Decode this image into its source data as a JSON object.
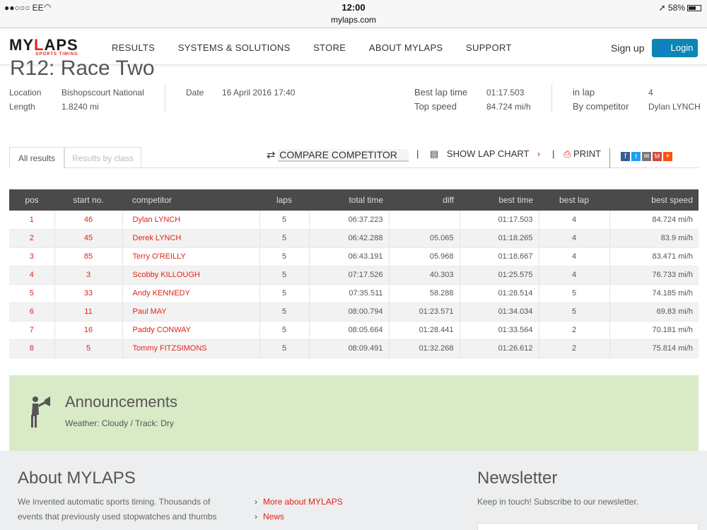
{
  "status": {
    "carrier": "●●○○○ EE",
    "time": "12:00",
    "url": "mylaps.com",
    "battery": "58%"
  },
  "nav": {
    "logo_main": "MYLAPS",
    "logo_sub": "SPORTS TIMING",
    "items": [
      "RESULTS",
      "SYSTEMS & SOLUTIONS",
      "STORE",
      "ABOUT MYLAPS",
      "SUPPORT"
    ],
    "signup": "Sign up",
    "login": "Login"
  },
  "race": {
    "title": "R12: Race Two",
    "location_label": "Location",
    "location": "Bishopscourt National",
    "length_label": "Length",
    "length": "1.8240 mi",
    "date_label": "Date",
    "date": "16 April 2016 17:40",
    "best_lap_time_label": "Best lap time",
    "best_lap_time": "01:17.503",
    "top_speed_label": "Top speed",
    "top_speed": "84.724 mi/h",
    "in_lap_label": "in lap",
    "in_lap": "4",
    "by_competitor_label": "By competitor",
    "by_competitor": "Dylan LYNCH"
  },
  "tabs": {
    "all": "All results",
    "by_class": "Results by class"
  },
  "tools": {
    "compare": "COMPARE COMPETITOR",
    "lap_chart": "SHOW LAP CHART",
    "print": "PRINT",
    "sep": "|"
  },
  "table": {
    "headers": [
      "pos",
      "start no.",
      "competitor",
      "laps",
      "total time",
      "diff",
      "best time",
      "best lap",
      "best speed"
    ],
    "rows": [
      [
        "1",
        "46",
        "Dylan LYNCH",
        "5",
        "06:37.223",
        "",
        "01:17.503",
        "4",
        "84.724 mi/h"
      ],
      [
        "2",
        "45",
        "Derek LYNCH",
        "5",
        "06:42.288",
        "05.065",
        "01:18.265",
        "4",
        "83.9 mi/h"
      ],
      [
        "3",
        "85",
        "Terry O'REILLY",
        "5",
        "06:43.191",
        "05.968",
        "01:18.667",
        "4",
        "83.471 mi/h"
      ],
      [
        "4",
        "3",
        "Scobby KILLOUGH",
        "5",
        "07:17.526",
        "40.303",
        "01:25.575",
        "4",
        "76.733 mi/h"
      ],
      [
        "5",
        "33",
        "Andy KENNEDY",
        "5",
        "07:35.511",
        "58.288",
        "01:28.514",
        "5",
        "74.185 mi/h"
      ],
      [
        "6",
        "11",
        "Paul MAY",
        "5",
        "08:00.794",
        "01:23.571",
        "01:34.034",
        "5",
        "69.83 mi/h"
      ],
      [
        "7",
        "16",
        "Paddy CONWAY",
        "5",
        "08:05.664",
        "01:28.441",
        "01:33.564",
        "2",
        "70.181 mi/h"
      ],
      [
        "8",
        "5",
        "Tommy FITZSIMONS",
        "5",
        "08:09.491",
        "01:32.268",
        "01:26.612",
        "2",
        "75.814 mi/h"
      ]
    ]
  },
  "announcements": {
    "title": "Announcements",
    "text": "Weather: Cloudy / Track: Dry"
  },
  "footer": {
    "about_title": "About MYLAPS",
    "about_text": "We invented automatic sports timing. Thousands of events that previously used stopwatches and thumbs",
    "links": [
      "More about MYLAPS",
      "News"
    ],
    "newsletter_title": "Newsletter",
    "newsletter_text": "Keep in touch! Subscribe to our newsletter."
  }
}
